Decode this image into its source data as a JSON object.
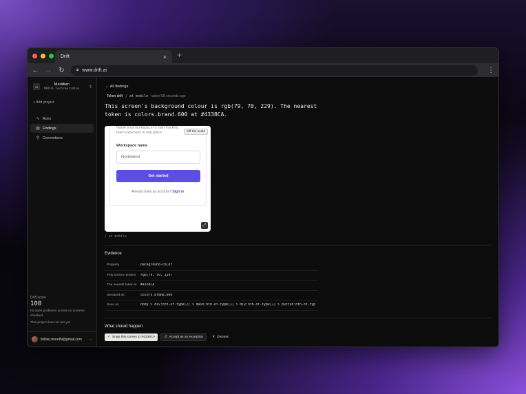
{
  "browser": {
    "tab_title": "Drift",
    "url": "www.drift.ai",
    "colors": {
      "close": "#ff5f57",
      "minimize": "#febc2e",
      "maximize": "#28c840"
    }
  },
  "sidebar": {
    "workspace_initial": "M",
    "workspace_name": "Meridian",
    "workspace_slug": "MRTHI-Tech/meridian",
    "add_project": "+ Add project",
    "nav": [
      {
        "label": "Runs",
        "icon": "activity-icon"
      },
      {
        "label": "Findings",
        "icon": "findings-icon",
        "active": true
      },
      {
        "label": "Conventions",
        "icon": "link-icon"
      }
    ],
    "drift_label": "Drift score",
    "drift_score": "100",
    "drift_text_1": "no open problems across no screens checked.",
    "drift_text_2": "This project has not run yet.",
    "user_email": "tlolliso.morethi@gmail.com"
  },
  "main": {
    "back_link": "← All findings",
    "chip": "Token drift",
    "viewport": "/ at mobile",
    "raised": "raised 58 seconds ago",
    "headline": "This screen's background colour is rgb(79, 70, 229). The nearest token is colors.brand.600 at #4338CA.",
    "preview": {
      "desc": "Name your workspace to start tracking team expenses in one place.",
      "field_label": "Workspace name",
      "field_placeholder": "Northwind",
      "button": "Get started",
      "signin_text": "Already have an account?",
      "signin_link": "Sign in",
      "off_scale": "Off the scale",
      "brand_color": "#5b4ee0"
    },
    "caption": "/ at mobile",
    "evidence_title": "Evidence",
    "evidence": [
      {
        "k": "Property",
        "v": "background-color"
      },
      {
        "k": "This screen renders",
        "v": "rgb(79, 70, 229)"
      },
      {
        "k": "The nearest token is",
        "v": "#4338CA"
      },
      {
        "k": "Declared as",
        "v": "colors.brand.600"
      },
      {
        "k": "Seen on",
        "v": "body > div:nth-of-type(2) > main:nth-of-type(1) > div:nth-of-type(1) > button:nth-of-typ"
      }
    ],
    "should_title": "What should happen",
    "actions": {
      "snap": "Snap this screen to #4338CA",
      "exception": "Accept as an exception",
      "dismiss": "Dismiss"
    }
  }
}
